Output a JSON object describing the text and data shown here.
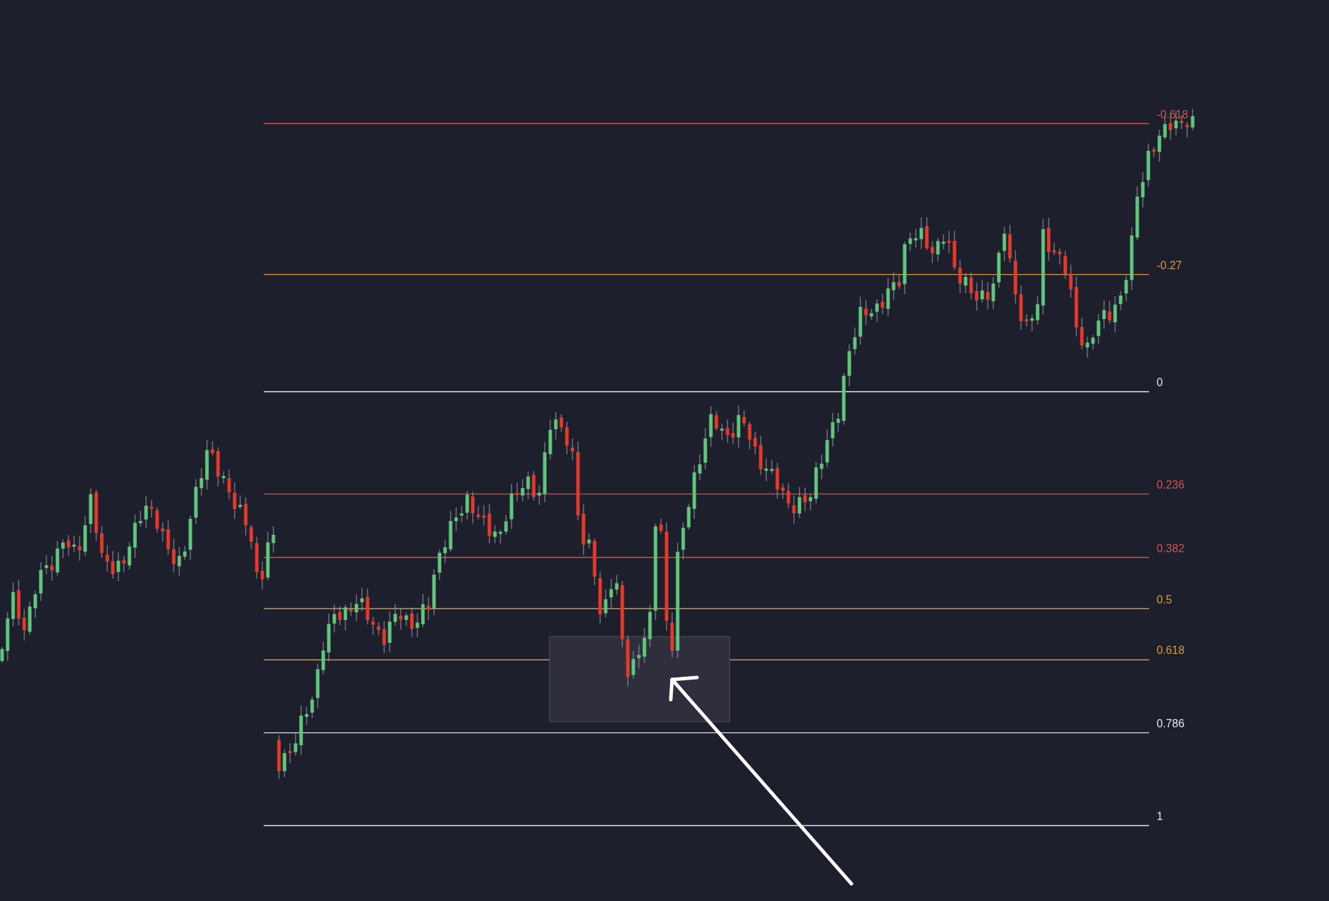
{
  "chart": {
    "fib_levels": [
      {
        "label": "-0.618",
        "color": "#d0544a"
      },
      {
        "label": "-0.27",
        "color": "#d99a36"
      },
      {
        "label": "0",
        "color": "#e6e6ea"
      },
      {
        "label": "0.236",
        "color": "#d0544a"
      },
      {
        "label": "0.382",
        "color": "#d0544a"
      },
      {
        "label": "0.5",
        "color": "#d99a36"
      },
      {
        "label": "0.618",
        "color": "#d99a36"
      },
      {
        "label": "0.786",
        "color": "#e6e6ea"
      },
      {
        "label": "1",
        "color": "#e6e6ea"
      }
    ]
  }
}
